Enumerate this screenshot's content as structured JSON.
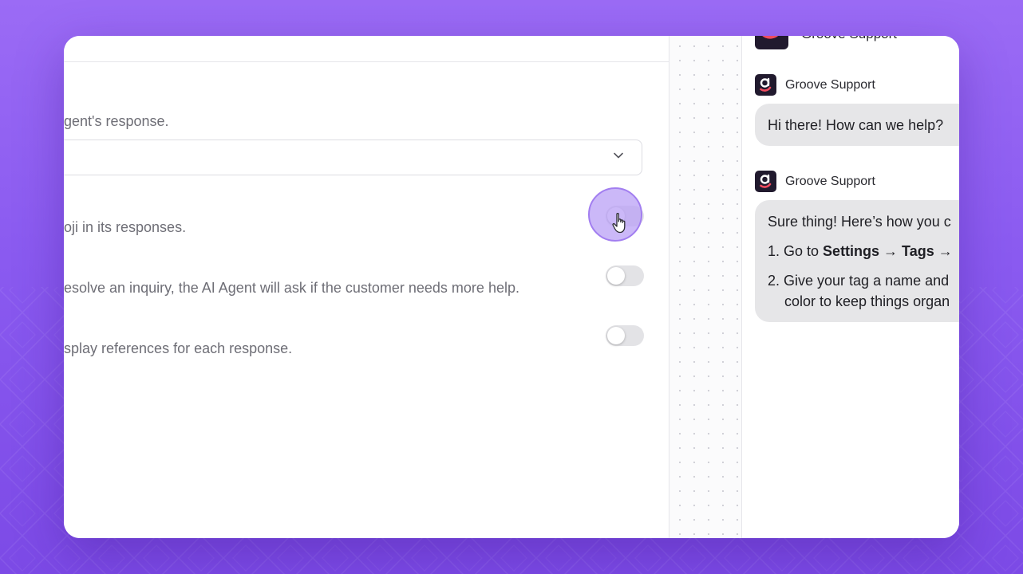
{
  "settings": {
    "response_length_desc": "gent's response.",
    "emoji_desc": "oji in its responses.",
    "follow_up_desc": "esolve an inquiry, the AI Agent will ask if the customer needs more help.",
    "references_desc": "splay references for each response.",
    "toggles": {
      "emoji": false,
      "follow_up": false,
      "references": false
    }
  },
  "chat_preview": {
    "header_name": "Groove Support",
    "messages": [
      {
        "sender": "Groove Support",
        "text": "Hi there! How can we help?"
      },
      {
        "sender": "Groove Support",
        "intro": "Sure thing! Here’s how you c",
        "step1_prefix": "1. Go to ",
        "step1_bold": "Settings → Tags →",
        "step2_line1": "2. Give your tag a name and",
        "step2_line2": "color to keep things organ"
      }
    ]
  },
  "icons": {
    "dropdown": "chevron-down-icon",
    "avatar": "groove-logo-icon",
    "cursor": "hand-pointer-icon"
  },
  "colors": {
    "background": "#8a5af0",
    "toggle_off": "#e3e3e6",
    "bubble": "#e6e6e8",
    "cursor_halo": "#baa0f5",
    "avatar_bg": "#211a2e",
    "logo_accent": "#ef4b5f"
  }
}
